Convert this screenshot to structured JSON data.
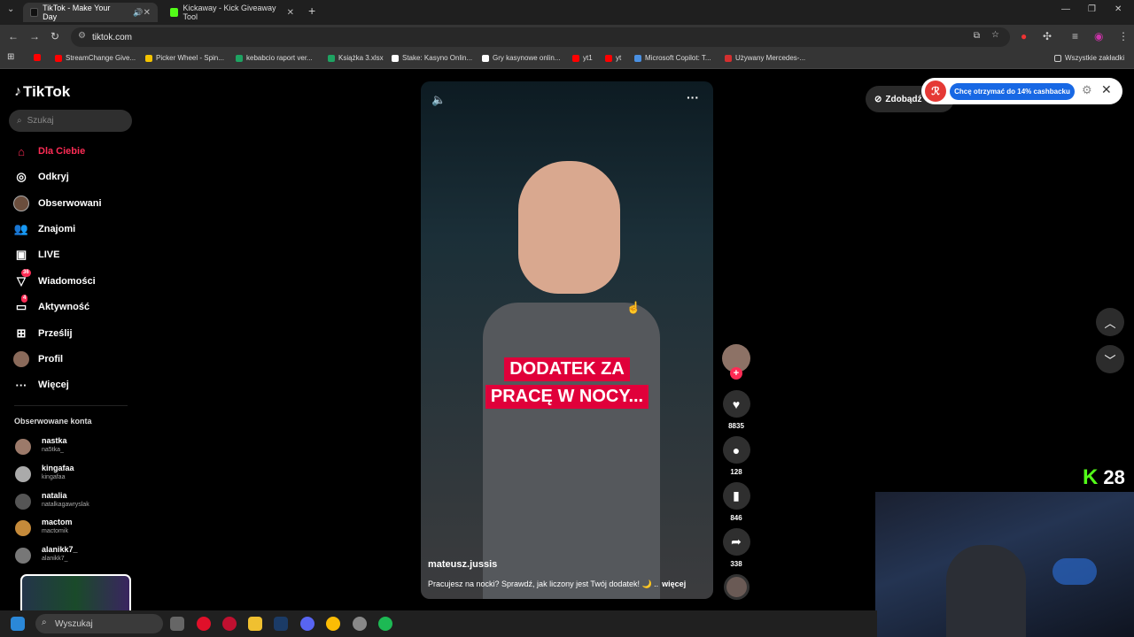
{
  "browser": {
    "tabs": [
      {
        "title": "TikTok - Make Your Day",
        "active": true
      },
      {
        "title": "Kickaway - Kick Giveaway Tool",
        "active": false
      }
    ],
    "new_tab": "+",
    "url": "tiktok.com",
    "bookmarks": [
      {
        "label": "StreamChange Give...",
        "color": "#ff0000"
      },
      {
        "label": "Picker Wheel - Spin...",
        "color": "#f3c300"
      },
      {
        "label": "kebabcio raport ver...",
        "color": "#1ea362"
      },
      {
        "label": "Książka 3.xlsx",
        "color": "#1ea362"
      },
      {
        "label": "Stake: Kasyno Onlin...",
        "color": "#ffffff"
      },
      {
        "label": "Gry kasynowe onlin...",
        "color": "#ffffff"
      },
      {
        "label": "yt1",
        "color": "#ff0000"
      },
      {
        "label": "yt",
        "color": "#ff0000"
      },
      {
        "label": "Microsoft Copilot: T...",
        "color": "#4a90e2"
      },
      {
        "label": "Używany Mercedes-...",
        "color": "#d32f2f"
      }
    ],
    "all_bookmarks": "Wszystkie zakładki"
  },
  "sidebar": {
    "logo": "TikTok",
    "search_placeholder": "Szukaj",
    "nav": [
      {
        "label": "Dla Ciebie",
        "icon": "home-icon",
        "active": true
      },
      {
        "label": "Odkryj",
        "icon": "compass-icon"
      },
      {
        "label": "Obserwowani",
        "icon": "avatar-icon"
      },
      {
        "label": "Znajomi",
        "icon": "friends-icon"
      },
      {
        "label": "LIVE",
        "icon": "live-icon"
      },
      {
        "label": "Wiadomości",
        "icon": "message-icon",
        "badge": "36"
      },
      {
        "label": "Aktywność",
        "icon": "activity-icon",
        "badge": "4"
      },
      {
        "label": "Prześlij",
        "icon": "upload-icon"
      },
      {
        "label": "Profil",
        "icon": "profile-icon"
      },
      {
        "label": "Więcej",
        "icon": "more-icon"
      }
    ],
    "followed_title": "Obserwowane konta",
    "accounts": [
      {
        "name": "nastka",
        "handle": "na5tka_"
      },
      {
        "name": "kingafaa",
        "handle": "kingafaa"
      },
      {
        "name": "natalia",
        "handle": "natalkagawryslak"
      },
      {
        "name": "mactom",
        "handle": "mactomik"
      },
      {
        "name": "alanikk7_",
        "handle": "alanikk7_"
      }
    ]
  },
  "video": {
    "caption_line1": "DODATEK ZA",
    "caption_line2": "PRACĘ W NOCY...",
    "author": "mateusz.jussis",
    "description": "Pracujesz na nocki? Sprawdź, jak liczony jest Twój dodatek! 🌙 ..",
    "more": "więcej"
  },
  "actions": {
    "likes": "8835",
    "comments": "128",
    "saves": "846",
    "shares": "338"
  },
  "promo": {
    "cashback": "Chcę otrzymać do 14% cashbacku",
    "get": "Zdobądź"
  },
  "overlay": {
    "kick_count": "28"
  },
  "taskbar": {
    "search": "Wyszukaj"
  },
  "colors": {
    "accent": "#fe2c55",
    "kick": "#53fc18",
    "caption_bg": "#e0003a"
  }
}
